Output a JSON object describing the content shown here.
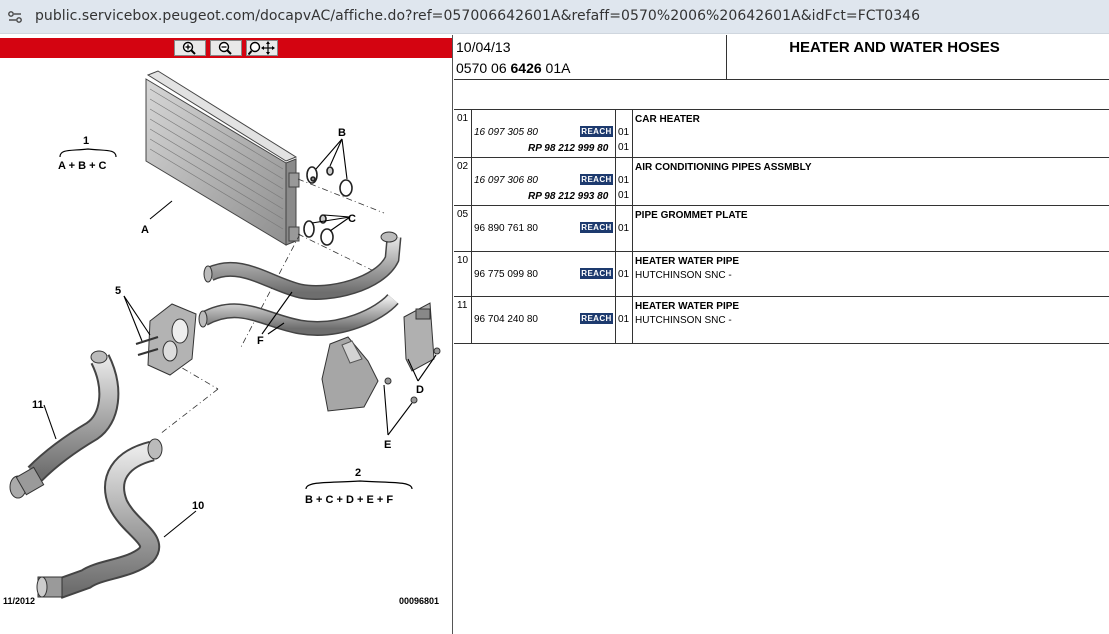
{
  "browser": {
    "url": "public.servicebox.peugeot.com/docapvAC/affiche.do?ref=057006642601A&refaff=0570%2006%20642601A&idFct=FCT0346"
  },
  "diagram": {
    "footer_date": "11/2012",
    "footer_code": "00096801",
    "callouts": {
      "group1_num": "1",
      "group1_formula": "A + B + C",
      "group2_num": "2",
      "group2_formula": "B + C + D + E + F",
      "A": "A",
      "B": "B",
      "C": "C",
      "D": "D",
      "E": "E",
      "F": "F",
      "n5": "5",
      "n11": "11",
      "n10": "10"
    }
  },
  "header": {
    "date": "10/04/13",
    "ref_prefix": "0570 06 ",
    "ref_bold": "6426",
    "ref_suffix": " 01A",
    "title": "HEATER AND WATER HOSES"
  },
  "parts": [
    {
      "ref": "01",
      "pn1": "16 097 305 80",
      "badge": "REACH",
      "qty1": "01",
      "pn2": "RP 98 212 999 80",
      "qty2": "01",
      "desc1": "CAR HEATER",
      "desc2": ""
    },
    {
      "ref": "02",
      "pn1": "16 097 306 80",
      "badge": "REACH",
      "qty1": "01",
      "pn2": "RP 98 212 993 80",
      "qty2": "01",
      "desc1": "AIR CONDITIONING PIPES ASSMBLY",
      "desc2": ""
    },
    {
      "ref": "05",
      "pn1": "96 890 761 80",
      "badge": "REACH",
      "qty1": "01",
      "pn2": "",
      "qty2": "",
      "desc1": "PIPE GROMMET PLATE",
      "desc2": ""
    },
    {
      "ref": "10",
      "pn1": "96 775 099 80",
      "badge": "REACH",
      "qty1": "01",
      "pn2": "",
      "qty2": "",
      "desc1": "HEATER WATER PIPE",
      "desc2": "HUTCHINSON SNC -"
    },
    {
      "ref": "11",
      "pn1": "96 704 240 80",
      "badge": "REACH",
      "qty1": "01",
      "pn2": "",
      "qty2": "",
      "desc1": "HEATER WATER PIPE",
      "desc2": "HUTCHINSON SNC -"
    }
  ],
  "colors": {
    "accent_red": "#d40411",
    "reach_badge": "#1d3a6e"
  },
  "icons": {
    "site_settings": "tune-icon",
    "zoom_in": "zoom-in-icon",
    "zoom_out": "zoom-out-icon",
    "zoom_move": "zoom-move-icon"
  }
}
